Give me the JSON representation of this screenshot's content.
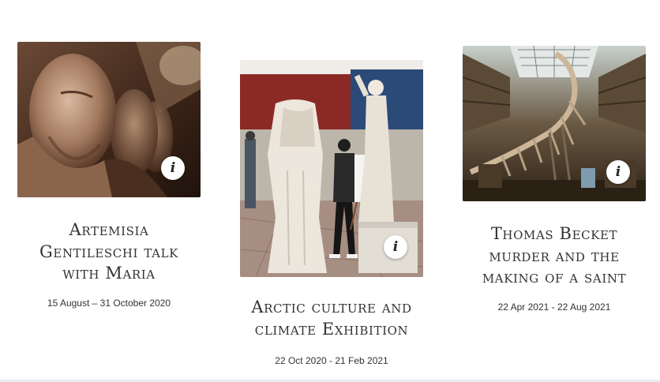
{
  "exhibitions": [
    {
      "title_lines": [
        "Artemisia",
        "Gentileschi talk",
        "with Maria"
      ],
      "dates": "15 August – 31 October 2020",
      "info_label": "i"
    },
    {
      "title_lines": [
        "Arctic culture and",
        "climate Exhibition"
      ],
      "dates": "22 Oct 2020 - 21 Feb 2021",
      "info_label": "i"
    },
    {
      "title_lines": [
        "Thomas Becket",
        "murder and the",
        "making of a saint"
      ],
      "dates": "22 Apr 2021 - 22 Aug 2021",
      "info_label": "i"
    }
  ]
}
